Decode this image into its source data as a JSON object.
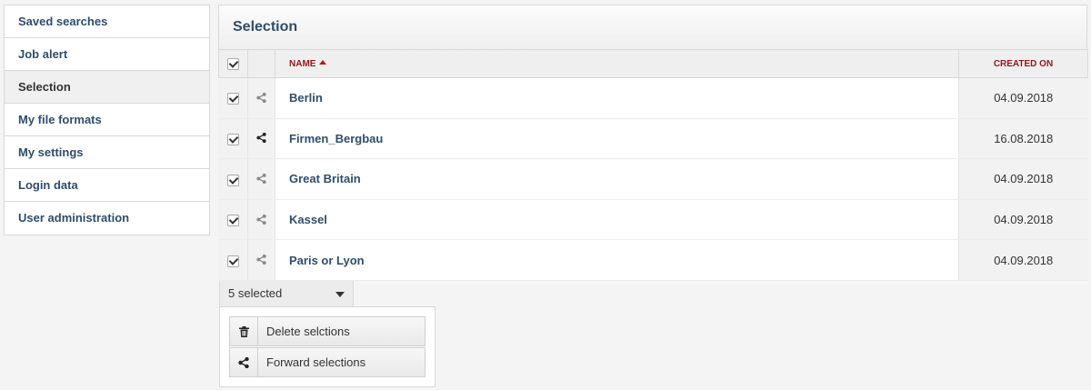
{
  "sidebar": {
    "items": [
      {
        "label": "Saved searches"
      },
      {
        "label": "Job alert"
      },
      {
        "label": "Selection"
      },
      {
        "label": "My file formats"
      },
      {
        "label": "My settings"
      },
      {
        "label": "Login data"
      },
      {
        "label": "User administration"
      }
    ],
    "active_index": 2
  },
  "panel": {
    "title": "Selection",
    "columns": {
      "name": "Name",
      "created_on": "Created on"
    },
    "sort": {
      "column": "name",
      "direction": "ascending"
    },
    "rows": [
      {
        "name": "Berlin",
        "created_on": "04.09.2018",
        "checked": true,
        "shared": false
      },
      {
        "name": "Firmen_Bergbau",
        "created_on": "16.08.2018",
        "checked": true,
        "shared": true
      },
      {
        "name": "Great Britain",
        "created_on": "04.09.2018",
        "checked": true,
        "shared": false
      },
      {
        "name": "Kassel",
        "created_on": "04.09.2018",
        "checked": true,
        "shared": false
      },
      {
        "name": "Paris or Lyon",
        "created_on": "04.09.2018",
        "checked": true,
        "shared": false
      }
    ]
  },
  "bulk": {
    "selected_label": "5 selected",
    "actions": [
      {
        "label": "Delete selctions",
        "icon": "trash-icon"
      },
      {
        "label": "Forward selections",
        "icon": "share-icon"
      }
    ]
  },
  "colors": {
    "link": "#2f4d6b",
    "header_label": "#8b1a1a",
    "sort_arrow": "#c0141a",
    "share_muted": "#888888",
    "share_active": "#222222"
  }
}
